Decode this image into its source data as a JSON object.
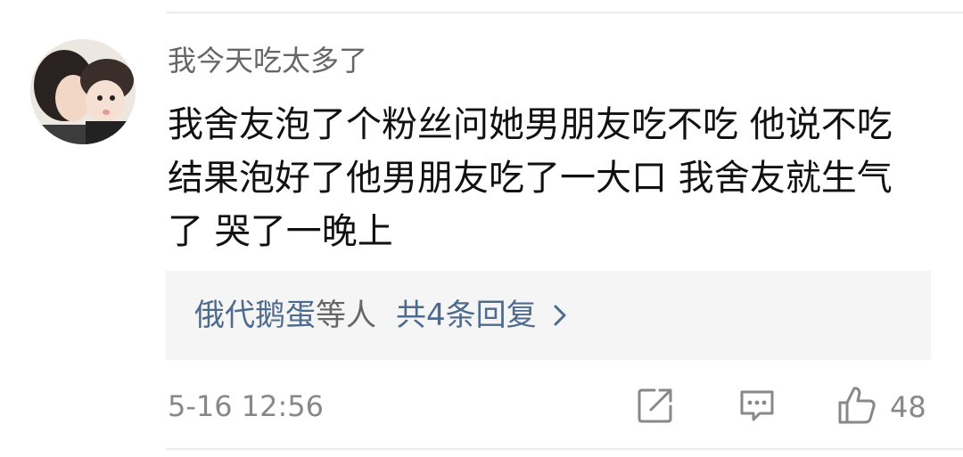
{
  "comment": {
    "username": "我今天吃太多了",
    "text": "我舍友泡了个粉丝问她男朋友吃不吃 他说不吃 结果泡好了他男朋友吃了一大口 我舍友就生气了 哭了一晚上",
    "replies": {
      "names": "俄代鹅蛋",
      "suffix": "等人",
      "count_label": "共4条回复"
    },
    "timestamp": "5-16 12:56",
    "like_count": "48",
    "icons": {
      "share": "share-icon",
      "comment": "comment-icon",
      "like": "thumbs-up-icon",
      "chevron": "chevron-right-icon"
    },
    "colors": {
      "link": "#4d6a8f",
      "text": "#111111",
      "muted": "#888888",
      "reply_bg": "#f5f5f5"
    }
  }
}
